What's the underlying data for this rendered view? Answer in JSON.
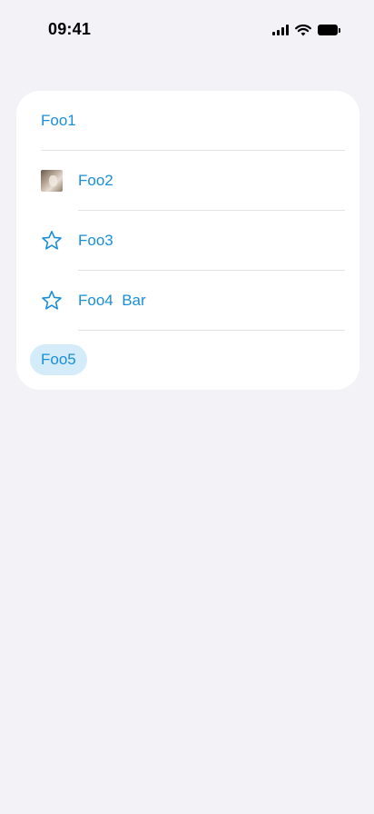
{
  "status_bar": {
    "time": "09:41"
  },
  "list": {
    "items": [
      {
        "label": "Foo1",
        "icon": ""
      },
      {
        "label": "Foo2",
        "icon": "photo-thumbnail"
      },
      {
        "label": "Foo3",
        "icon": "star-icon"
      },
      {
        "label": "Foo4  Bar",
        "icon": "star-icon"
      }
    ],
    "chip_label": "Foo5"
  },
  "colors": {
    "background": "#f2f2f7",
    "card": "#ffffff",
    "accent": "#1a8fd9",
    "chip_background": "#d4ebfa",
    "divider": "#e2e2e7"
  }
}
